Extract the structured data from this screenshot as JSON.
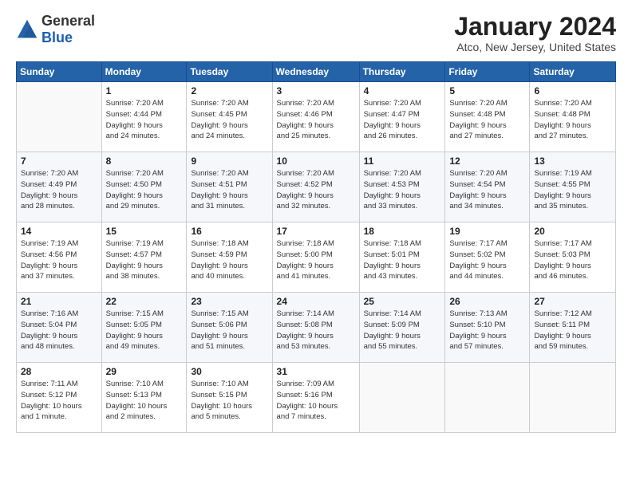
{
  "header": {
    "logo_general": "General",
    "logo_blue": "Blue",
    "title": "January 2024",
    "subtitle": "Atco, New Jersey, United States"
  },
  "weekdays": [
    "Sunday",
    "Monday",
    "Tuesday",
    "Wednesday",
    "Thursday",
    "Friday",
    "Saturday"
  ],
  "weeks": [
    [
      {
        "day": "",
        "info": ""
      },
      {
        "day": "1",
        "info": "Sunrise: 7:20 AM\nSunset: 4:44 PM\nDaylight: 9 hours\nand 24 minutes."
      },
      {
        "day": "2",
        "info": "Sunrise: 7:20 AM\nSunset: 4:45 PM\nDaylight: 9 hours\nand 24 minutes."
      },
      {
        "day": "3",
        "info": "Sunrise: 7:20 AM\nSunset: 4:46 PM\nDaylight: 9 hours\nand 25 minutes."
      },
      {
        "day": "4",
        "info": "Sunrise: 7:20 AM\nSunset: 4:47 PM\nDaylight: 9 hours\nand 26 minutes."
      },
      {
        "day": "5",
        "info": "Sunrise: 7:20 AM\nSunset: 4:48 PM\nDaylight: 9 hours\nand 27 minutes."
      },
      {
        "day": "6",
        "info": "Sunrise: 7:20 AM\nSunset: 4:48 PM\nDaylight: 9 hours\nand 27 minutes."
      }
    ],
    [
      {
        "day": "7",
        "info": "Sunrise: 7:20 AM\nSunset: 4:49 PM\nDaylight: 9 hours\nand 28 minutes."
      },
      {
        "day": "8",
        "info": "Sunrise: 7:20 AM\nSunset: 4:50 PM\nDaylight: 9 hours\nand 29 minutes."
      },
      {
        "day": "9",
        "info": "Sunrise: 7:20 AM\nSunset: 4:51 PM\nDaylight: 9 hours\nand 31 minutes."
      },
      {
        "day": "10",
        "info": "Sunrise: 7:20 AM\nSunset: 4:52 PM\nDaylight: 9 hours\nand 32 minutes."
      },
      {
        "day": "11",
        "info": "Sunrise: 7:20 AM\nSunset: 4:53 PM\nDaylight: 9 hours\nand 33 minutes."
      },
      {
        "day": "12",
        "info": "Sunrise: 7:20 AM\nSunset: 4:54 PM\nDaylight: 9 hours\nand 34 minutes."
      },
      {
        "day": "13",
        "info": "Sunrise: 7:19 AM\nSunset: 4:55 PM\nDaylight: 9 hours\nand 35 minutes."
      }
    ],
    [
      {
        "day": "14",
        "info": "Sunrise: 7:19 AM\nSunset: 4:56 PM\nDaylight: 9 hours\nand 37 minutes."
      },
      {
        "day": "15",
        "info": "Sunrise: 7:19 AM\nSunset: 4:57 PM\nDaylight: 9 hours\nand 38 minutes."
      },
      {
        "day": "16",
        "info": "Sunrise: 7:18 AM\nSunset: 4:59 PM\nDaylight: 9 hours\nand 40 minutes."
      },
      {
        "day": "17",
        "info": "Sunrise: 7:18 AM\nSunset: 5:00 PM\nDaylight: 9 hours\nand 41 minutes."
      },
      {
        "day": "18",
        "info": "Sunrise: 7:18 AM\nSunset: 5:01 PM\nDaylight: 9 hours\nand 43 minutes."
      },
      {
        "day": "19",
        "info": "Sunrise: 7:17 AM\nSunset: 5:02 PM\nDaylight: 9 hours\nand 44 minutes."
      },
      {
        "day": "20",
        "info": "Sunrise: 7:17 AM\nSunset: 5:03 PM\nDaylight: 9 hours\nand 46 minutes."
      }
    ],
    [
      {
        "day": "21",
        "info": "Sunrise: 7:16 AM\nSunset: 5:04 PM\nDaylight: 9 hours\nand 48 minutes."
      },
      {
        "day": "22",
        "info": "Sunrise: 7:15 AM\nSunset: 5:05 PM\nDaylight: 9 hours\nand 49 minutes."
      },
      {
        "day": "23",
        "info": "Sunrise: 7:15 AM\nSunset: 5:06 PM\nDaylight: 9 hours\nand 51 minutes."
      },
      {
        "day": "24",
        "info": "Sunrise: 7:14 AM\nSunset: 5:08 PM\nDaylight: 9 hours\nand 53 minutes."
      },
      {
        "day": "25",
        "info": "Sunrise: 7:14 AM\nSunset: 5:09 PM\nDaylight: 9 hours\nand 55 minutes."
      },
      {
        "day": "26",
        "info": "Sunrise: 7:13 AM\nSunset: 5:10 PM\nDaylight: 9 hours\nand 57 minutes."
      },
      {
        "day": "27",
        "info": "Sunrise: 7:12 AM\nSunset: 5:11 PM\nDaylight: 9 hours\nand 59 minutes."
      }
    ],
    [
      {
        "day": "28",
        "info": "Sunrise: 7:11 AM\nSunset: 5:12 PM\nDaylight: 10 hours\nand 1 minute."
      },
      {
        "day": "29",
        "info": "Sunrise: 7:10 AM\nSunset: 5:13 PM\nDaylight: 10 hours\nand 2 minutes."
      },
      {
        "day": "30",
        "info": "Sunrise: 7:10 AM\nSunset: 5:15 PM\nDaylight: 10 hours\nand 5 minutes."
      },
      {
        "day": "31",
        "info": "Sunrise: 7:09 AM\nSunset: 5:16 PM\nDaylight: 10 hours\nand 7 minutes."
      },
      {
        "day": "",
        "info": ""
      },
      {
        "day": "",
        "info": ""
      },
      {
        "day": "",
        "info": ""
      }
    ]
  ]
}
